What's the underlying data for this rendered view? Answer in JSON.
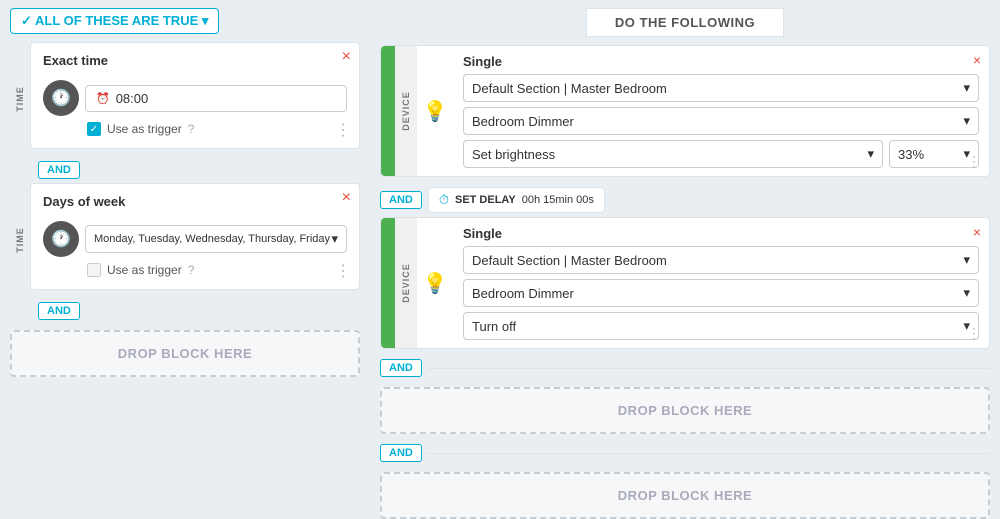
{
  "leftPanel": {
    "allOfThese": "✓ ALL OF THESE ARE TRUE ▾",
    "block1": {
      "title": "Exact time",
      "timeValue": "08:00",
      "timeIcon": "🕐",
      "useTrigger": "Use as trigger",
      "triggerHelp": "?",
      "checked": true
    },
    "andBadge1": "AND",
    "block2": {
      "title": "Days of week",
      "days": "Monday, Tuesday, Wednesday, Thursday, Friday",
      "useTrigger": "Use as trigger",
      "triggerHelp": "?"
    },
    "andBadge2": "AND",
    "dropBlock": "DROP BLOCK HERE"
  },
  "rightPanel": {
    "doFollowing": "DO THE FOLLOWING",
    "action1": {
      "title": "Single",
      "section": "Default Section | Master Bedroom",
      "device": "Bedroom Dimmer",
      "actionLabel": "Set brightness",
      "brightness": "33%"
    },
    "andBadge1": "AND",
    "setDelay": {
      "label": "SET DELAY",
      "value": "00h 15min 00s"
    },
    "action2": {
      "title": "Single",
      "section": "Default Section | Master Bedroom",
      "device": "Bedroom Dimmer",
      "actionLabel": "Turn off"
    },
    "andBadge2": "AND",
    "dropBlock1": "DROP BLOCK HERE",
    "andBadge3": "AND",
    "dropBlock2": "DROP BLOCK HERE",
    "sideLabel": "DEVICE",
    "chevron": "▾",
    "closeX": "×",
    "dragHandle": "⋮"
  }
}
